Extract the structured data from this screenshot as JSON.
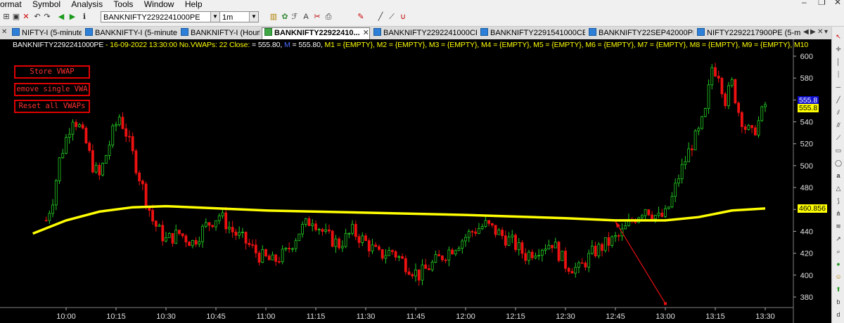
{
  "menu": [
    "ormat",
    "Symbol",
    "Analysis",
    "Tools",
    "Window",
    "Help"
  ],
  "toolbar": {
    "symbol_value": "BANKNIFTY2292241000PE",
    "interval_value": "1m"
  },
  "tabs": [
    {
      "label": "NIFTY-I (5-minute)",
      "active": false
    },
    {
      "label": "BANKNIFTY-I (5-minute)",
      "active": false
    },
    {
      "label": "BANKNIFTY-I (Hourly)",
      "active": false
    },
    {
      "label": "BANKNIFTY22922410...",
      "active": true
    },
    {
      "label": "BANKNIFTY2292241000CE (...",
      "active": false
    },
    {
      "label": "BANKNIFTY2291541000CE (...",
      "active": false
    },
    {
      "label": "BANKNIFTY22SEP42000PE (...",
      "active": false
    },
    {
      "label": "NIFTY2292217900PE (5-min...",
      "active": false
    }
  ],
  "header": {
    "symbol": "BANKNIFTY2292241000PE",
    "sep": " - ",
    "datetime": "16-09-2022 13:30:00",
    "vwaps": "No.VWAPs: 22",
    "close_label": "Close:",
    "close_value": "= 555.80,",
    "m_label": "M",
    "m_value": "= 555.80,",
    "mslots": "M1 = {EMPTY}, M2 = {EMPTY}, M3 = {EMPTY}, M4 = {EMPTY}, M5 = {EMPTY}, M6 = {EMPTY}, M7 = {EMPTY}, M8 = {EMPTY}, M9 = {EMPTY}, M10"
  },
  "buttons": {
    "store": "Store VWAP",
    "remove": "emove single VWA",
    "reset": "Reset all VWAPs"
  },
  "scale": {
    "last_blue": "555.8",
    "last_yellow": "555.8",
    "vwap_value": "460.856"
  },
  "colors": {
    "up": "#22cc22",
    "down": "#ee1111",
    "vwap": "#ffff00",
    "background": "#000000",
    "arrow": "#e81010"
  },
  "chart_data": {
    "type": "candlestick",
    "title": "BANKNIFTY2292241000PE",
    "date": "16-09-2022",
    "interval": "1m",
    "ylim": [
      370,
      610
    ],
    "y_ticks": [
      380,
      400,
      420,
      440,
      460,
      480,
      500,
      520,
      540,
      560,
      580,
      600
    ],
    "x_ticks": [
      "10:00",
      "10:15",
      "10:30",
      "10:45",
      "11:00",
      "11:15",
      "11:30",
      "11:45",
      "12:00",
      "12:15",
      "12:30",
      "12:45",
      "13:00",
      "13:15",
      "13:30"
    ],
    "grid": false,
    "close_path": [
      [
        "09:54",
        450
      ],
      [
        "09:56",
        470
      ],
      [
        "09:58",
        505
      ],
      [
        "10:00",
        525
      ],
      [
        "10:02",
        545
      ],
      [
        "10:04",
        535
      ],
      [
        "10:06",
        520
      ],
      [
        "10:08",
        500
      ],
      [
        "10:10",
        490
      ],
      [
        "10:12",
        510
      ],
      [
        "10:14",
        530
      ],
      [
        "10:16",
        545
      ],
      [
        "10:18",
        530
      ],
      [
        "10:20",
        510
      ],
      [
        "10:22",
        490
      ],
      [
        "10:24",
        470
      ],
      [
        "10:26",
        450
      ],
      [
        "10:28",
        440
      ],
      [
        "10:30",
        432
      ],
      [
        "10:34",
        438
      ],
      [
        "10:38",
        430
      ],
      [
        "10:42",
        445
      ],
      [
        "10:46",
        455
      ],
      [
        "10:50",
        440
      ],
      [
        "10:54",
        430
      ],
      [
        "10:58",
        418
      ],
      [
        "11:02",
        412
      ],
      [
        "11:06",
        420
      ],
      [
        "11:10",
        440
      ],
      [
        "11:14",
        452
      ],
      [
        "11:18",
        436
      ],
      [
        "11:22",
        428
      ],
      [
        "11:26",
        440
      ],
      [
        "11:30",
        430
      ],
      [
        "11:34",
        418
      ],
      [
        "11:38",
        422
      ],
      [
        "11:42",
        410
      ],
      [
        "11:46",
        400
      ],
      [
        "11:50",
        410
      ],
      [
        "11:54",
        420
      ],
      [
        "11:58",
        430
      ],
      [
        "12:02",
        440
      ],
      [
        "12:06",
        446
      ],
      [
        "12:10",
        438
      ],
      [
        "12:14",
        430
      ],
      [
        "12:18",
        418
      ],
      [
        "12:22",
        425
      ],
      [
        "12:26",
        430
      ],
      [
        "12:30",
        410
      ],
      [
        "12:34",
        405
      ],
      [
        "12:38",
        420
      ],
      [
        "12:42",
        428
      ],
      [
        "12:46",
        435
      ],
      [
        "12:50",
        450
      ],
      [
        "12:54",
        462
      ],
      [
        "12:58",
        452
      ],
      [
        "13:00",
        455
      ],
      [
        "13:02",
        470
      ],
      [
        "13:04",
        490
      ],
      [
        "13:06",
        505
      ],
      [
        "13:08",
        520
      ],
      [
        "13:10",
        530
      ],
      [
        "13:12",
        548
      ],
      [
        "13:14",
        590
      ],
      [
        "13:16",
        585
      ],
      [
        "13:18",
        560
      ],
      [
        "13:20",
        575
      ],
      [
        "13:22",
        550
      ],
      [
        "13:24",
        535
      ],
      [
        "13:26",
        528
      ],
      [
        "13:28",
        540
      ],
      [
        "13:30",
        555.8
      ]
    ],
    "series": [
      {
        "name": "VWAP",
        "color": "#ffff00",
        "points": [
          [
            "09:50",
            438
          ],
          [
            "10:00",
            450
          ],
          [
            "10:10",
            458
          ],
          [
            "10:20",
            462
          ],
          [
            "10:30",
            463
          ],
          [
            "11:00",
            459
          ],
          [
            "11:30",
            457
          ],
          [
            "12:00",
            455
          ],
          [
            "12:30",
            452
          ],
          [
            "12:45",
            450
          ],
          [
            "13:00",
            450
          ],
          [
            "13:10",
            453
          ],
          [
            "13:20",
            459
          ],
          [
            "13:30",
            460.856
          ]
        ]
      }
    ],
    "last_close": 555.8,
    "vwap_last": 460.856
  }
}
